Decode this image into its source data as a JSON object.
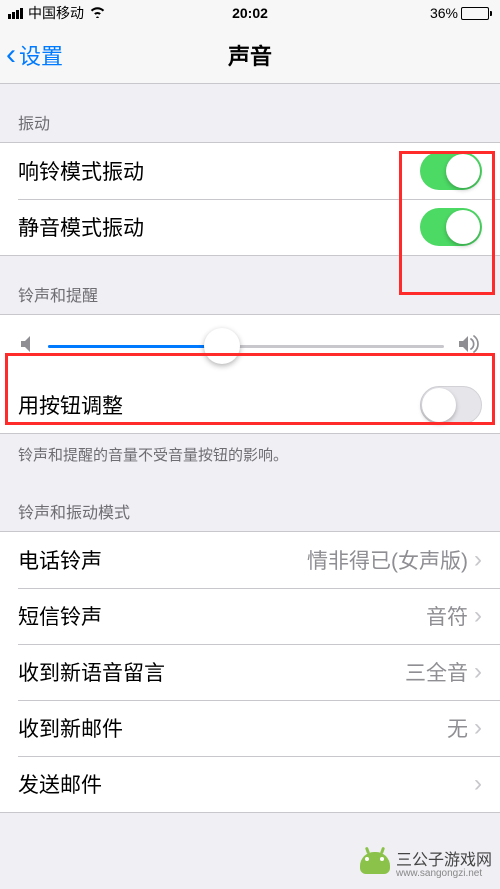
{
  "status": {
    "carrier": "中国移动",
    "time": "20:02",
    "battery_pct": "36%",
    "battery_fill_pct": 36
  },
  "nav": {
    "back_label": "设置",
    "title": "声音"
  },
  "sections": {
    "vibration": {
      "header": "振动",
      "ring_vibrate": {
        "label": "响铃模式振动",
        "on": true
      },
      "silent_vibrate": {
        "label": "静音模式振动",
        "on": true
      }
    },
    "ringer": {
      "header": "铃声和提醒",
      "slider_pct": 44,
      "adjust_with_buttons": {
        "label": "用按钮调整",
        "on": false
      },
      "footer": "铃声和提醒的音量不受音量按钮的影响。"
    },
    "patterns": {
      "header": "铃声和振动模式",
      "items": [
        {
          "label": "电话铃声",
          "value": "情非得已(女声版)"
        },
        {
          "label": "短信铃声",
          "value": "音符"
        },
        {
          "label": "收到新语音留言",
          "value": "三全音"
        },
        {
          "label": "收到新邮件",
          "value": "无"
        },
        {
          "label": "发送邮件",
          "value": ""
        }
      ]
    }
  },
  "watermark": {
    "line1": "三公子游戏网",
    "line2": "www.sangongzi.net"
  }
}
